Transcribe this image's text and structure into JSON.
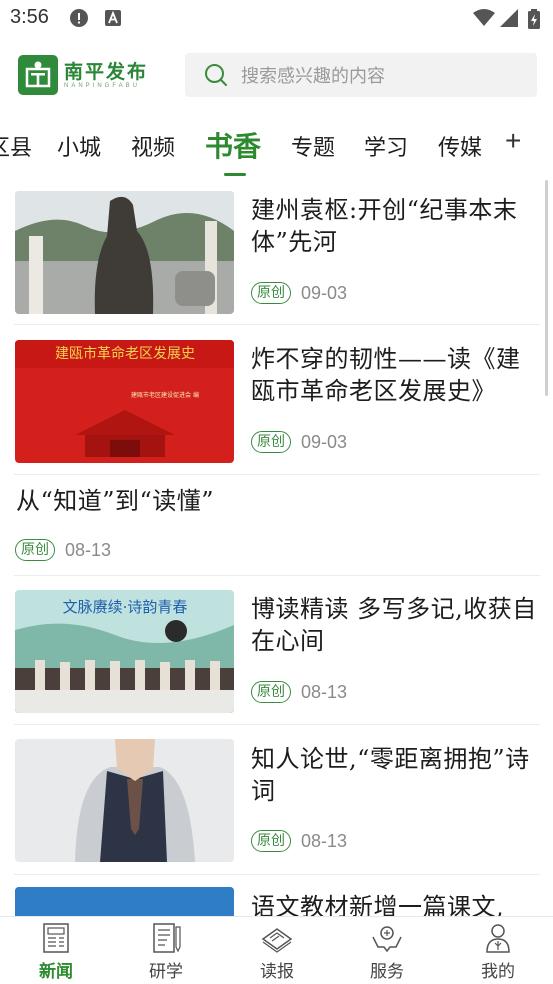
{
  "status_bar": {
    "time": "3:56"
  },
  "header": {
    "logo_cn": "南平发布",
    "logo_en": "NANPINGFABU",
    "search_placeholder": "搜索感兴趣的内容"
  },
  "tabs": [
    {
      "label": "区县"
    },
    {
      "label": "小城"
    },
    {
      "label": "视频"
    },
    {
      "label": "书香",
      "active": true
    },
    {
      "label": "专题"
    },
    {
      "label": "学习"
    },
    {
      "label": "传媒"
    }
  ],
  "tab_plus": "+",
  "articles": [
    {
      "title": "建州袁枢:开创“纪事本末体”先河",
      "badge": "原创",
      "date": "09-03"
    },
    {
      "title": "炸不穿的韧性——读《建瓯市革命老区发展史》",
      "badge": "原创",
      "date": "09-03",
      "thumb_text": "建瓯市革命老区发展史",
      "thumb_sub": "建瓯市老区建设促进会  编"
    },
    {
      "title": "从“知道”到“读懂”",
      "badge": "原创",
      "date": "08-13"
    },
    {
      "title": "博读精读  多写多记,收获自在心间",
      "badge": "原创",
      "date": "08-13",
      "thumb_text": "文脉赓续·诗韵青春"
    },
    {
      "title": "知人论世,“零距离拥抱”诗词",
      "badge": "原创",
      "date": "08-13"
    },
    {
      "title": "语文教材新增一篇课文,",
      "badge": "",
      "date": ""
    }
  ],
  "bottom_nav": [
    {
      "label": "新闻",
      "icon": "newspaper-icon",
      "active": true
    },
    {
      "label": "研学",
      "icon": "notebook-icon"
    },
    {
      "label": "读报",
      "icon": "paper-icon"
    },
    {
      "label": "服务",
      "icon": "hands-icon"
    },
    {
      "label": "我的",
      "icon": "user-icon"
    }
  ],
  "colors": {
    "accent": "#2d8a2f",
    "badge": "#3a8b3f"
  }
}
